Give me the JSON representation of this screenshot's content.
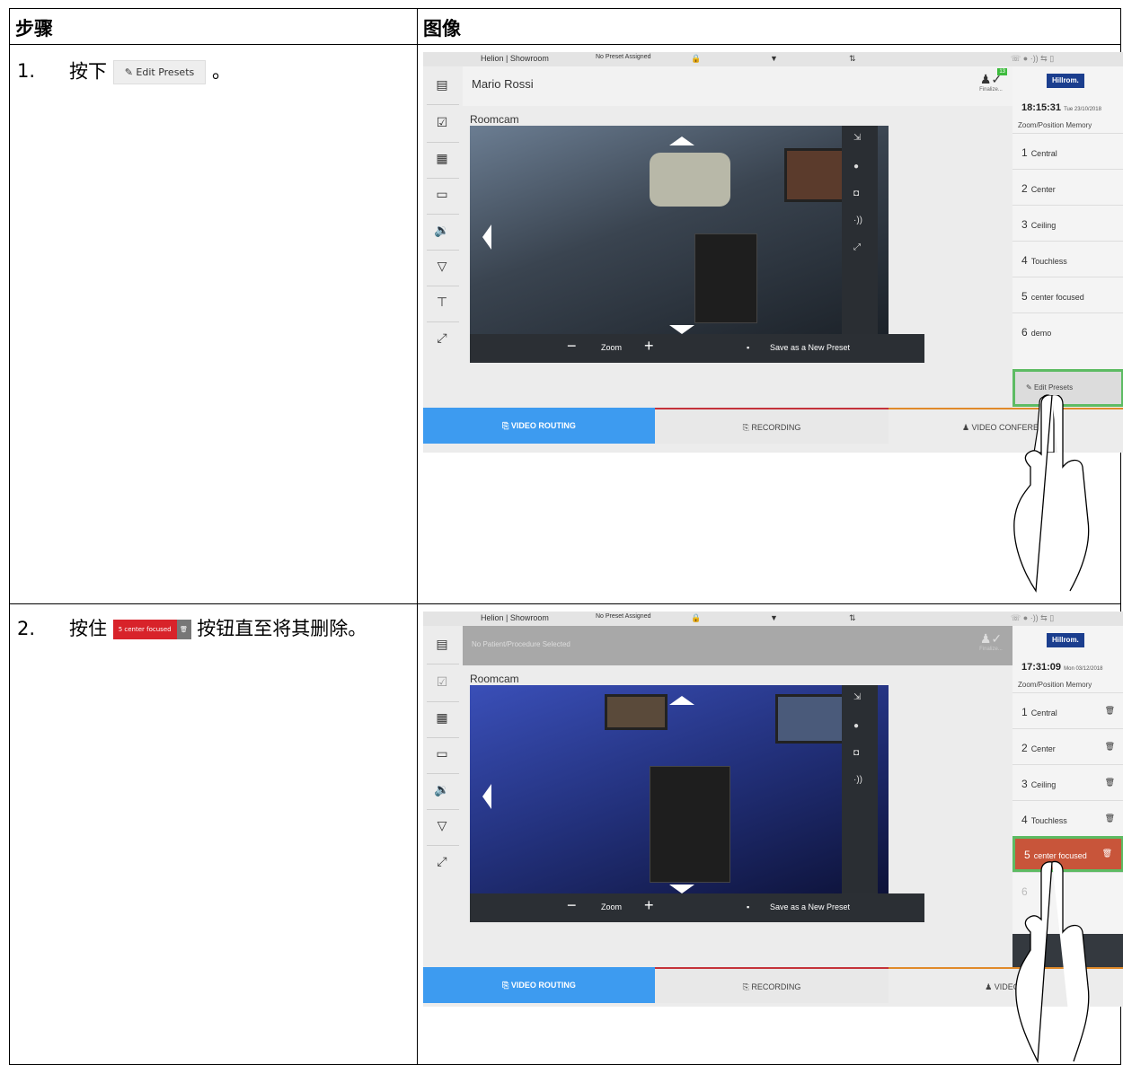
{
  "table": {
    "header_steps": "步骤",
    "header_image": "图像"
  },
  "steps": [
    {
      "number": "1.",
      "text_before": "按下",
      "button_label": "Edit Presets",
      "text_after": "。"
    },
    {
      "number": "2.",
      "text_before": "按住",
      "preset_number": "5",
      "preset_label": "center focused",
      "text_after": "按钮直至将其删除。"
    }
  ],
  "screen1": {
    "topbar": {
      "location": "Helion | Showroom",
      "preset_status": "No Preset Assigned"
    },
    "patient_name": "Mario Rossi",
    "finalize_label": "Finalize...",
    "badge_count": "13",
    "brand": "Hillrom.",
    "time": "18:15:31",
    "date": "Tue 23/10/2018",
    "panel_title": "Zoom/Position Memory",
    "room_label": "Roomcam",
    "presets": [
      {
        "n": "1",
        "label": "Central"
      },
      {
        "n": "2",
        "label": "Center"
      },
      {
        "n": "3",
        "label": "Ceiling"
      },
      {
        "n": "4",
        "label": "Touchless"
      },
      {
        "n": "5",
        "label": "center focused"
      },
      {
        "n": "6",
        "label": "demo"
      }
    ],
    "edit_presets": "Edit Presets",
    "zoom_label": "Zoom",
    "save_label": "Save as a New Preset",
    "tabs": [
      "VIDEO ROUTING",
      "RECORDING",
      "VIDEO CONFERENC"
    ]
  },
  "screen2": {
    "topbar": {
      "location": "Helion | Showroom",
      "preset_status": "No Preset Assigned"
    },
    "patient_name": "No Patient/Procedure Selected",
    "finalize_label": "Finalize...",
    "brand": "Hillrom.",
    "time": "17:31:09",
    "date": "Mon 03/12/2018",
    "panel_title": "Zoom/Position Memory",
    "room_label": "Roomcam",
    "presets": [
      {
        "n": "1",
        "label": "Central"
      },
      {
        "n": "2",
        "label": "Center"
      },
      {
        "n": "3",
        "label": "Ceiling"
      },
      {
        "n": "4",
        "label": "Touchless"
      },
      {
        "n": "5",
        "label": "center focused"
      },
      {
        "n": "6",
        "label": ""
      }
    ],
    "zoom_label": "Zoom",
    "save_label": "Save as a New Preset",
    "tabs": [
      "VIDEO ROUTING",
      "RECORDING",
      "VIDEO C"
    ]
  },
  "colors": {
    "highlight_green": "#5dbb63",
    "tab_blue": "#3d9bf0",
    "delete_red": "#d8232a",
    "brand_navy": "#1b3e8e"
  }
}
